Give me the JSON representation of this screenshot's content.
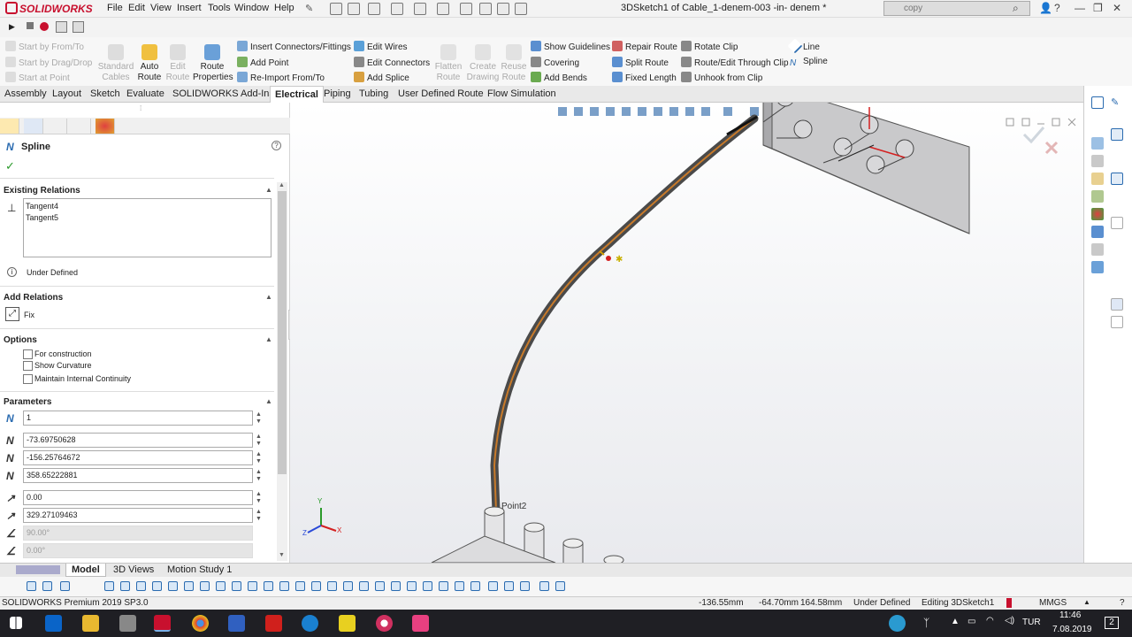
{
  "app": {
    "logo_text": "SOLIDWORKS",
    "menus": [
      "File",
      "Edit",
      "View",
      "Insert",
      "Tools",
      "Window",
      "Help"
    ],
    "doc_title": "3DSketch1 of Cable_1-denem-003 -in- denem *",
    "search_value": "copy",
    "colors": {
      "accent": "#c8102e",
      "route": "#c87a2a",
      "cable": "#5a5a5a"
    }
  },
  "command_manager": {
    "route_from": [
      "Start by From/To",
      "Start by Drag/Drop",
      "Start at Point"
    ],
    "big_buttons": [
      {
        "label": "Standard\nCables",
        "enabled": false
      },
      {
        "label": "Auto\nRoute",
        "enabled": true
      },
      {
        "label": "Edit\nRoute",
        "enabled": false
      },
      {
        "label": "Route\nProperties",
        "enabled": true
      }
    ],
    "col1": [
      "Insert Connectors/Fittings",
      "Add Point",
      "Re-Import From/To"
    ],
    "col2": [
      "Edit Wires",
      "Edit Connectors",
      "Add Splice"
    ],
    "mid_buttons": [
      "Flatten\nRoute",
      "Create\nDrawing",
      "Reuse\nRoute"
    ],
    "col3": [
      "Show Guidelines",
      "Covering",
      "Add Bends"
    ],
    "col4": [
      "Repair Route",
      "Split Route",
      "Fixed Length"
    ],
    "col5": [
      "Rotate Clip",
      "Route/Edit Through Clip",
      "Unhook from Clip"
    ],
    "col6": [
      "Line",
      "Spline"
    ]
  },
  "tabs": [
    "Assembly",
    "Layout",
    "Sketch",
    "Evaluate",
    "SOLIDWORKS Add-Ins",
    "Electrical",
    "Piping",
    "Tubing",
    "User Defined Route",
    "Flow Simulation"
  ],
  "active_tab": "Electrical",
  "property_manager": {
    "title": "Spline",
    "existing_relations_header": "Existing Relations",
    "relations": [
      "Tangent4",
      "Tangent5"
    ],
    "status": "Under Defined",
    "add_relations_header": "Add Relations",
    "add_relation_item": "Fix",
    "options_header": "Options",
    "options": [
      {
        "label": "For construction",
        "checked": false
      },
      {
        "label": "Show Curvature",
        "checked": false
      },
      {
        "label": "Maintain Internal Continuity",
        "checked": false
      }
    ],
    "parameters_header": "Parameters",
    "parameters": [
      "1",
      "-73.69750628",
      "-156.25764672",
      "358.65222881",
      "0.00",
      "329.27109463",
      "90.00°",
      "0.00°"
    ]
  },
  "viewport": {
    "point_label": "Point2",
    "axes": {
      "x": "X",
      "y": "Y",
      "z": "Z"
    }
  },
  "bottom_tabs": [
    "Model",
    "3D Views",
    "Motion Study 1"
  ],
  "status_bar": {
    "product": "SOLIDWORKS Premium 2019 SP3.0",
    "x": "-136.55mm",
    "y": "-64.70mm",
    "z": "164.58mm",
    "state": "Under Defined",
    "editing": "Editing 3DSketch1",
    "units": "MMGS"
  },
  "taskbar": {
    "lang": "TUR",
    "time": "11:46",
    "date": "7.08.2019",
    "notifications": "2"
  }
}
